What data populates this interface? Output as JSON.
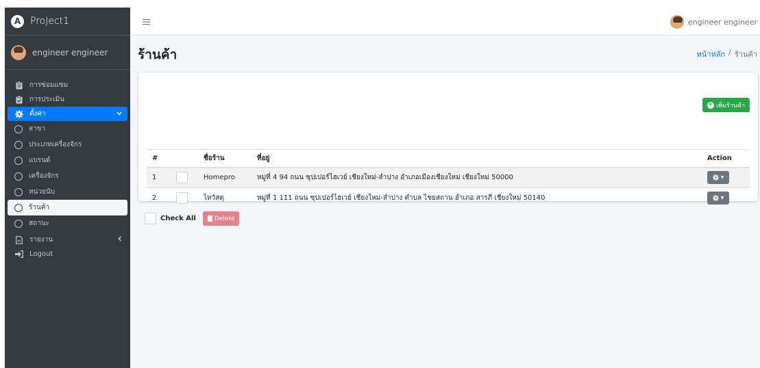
{
  "brand": {
    "logo_letter": "A",
    "name": "ProJect1"
  },
  "user": {
    "name": "engineer engineer"
  },
  "sidebar": {
    "items": [
      {
        "label": "การซ่อมแซม",
        "icon": "clipboard-icon"
      },
      {
        "label": "การประเมิน",
        "icon": "clipboard-check-icon"
      },
      {
        "label": "ตั้งค่า",
        "icon": "gear-icon",
        "active": true
      }
    ],
    "settings_sub": [
      {
        "label": "สาขา"
      },
      {
        "label": "ประเภทเครื่องจักร"
      },
      {
        "label": "แบรนด์"
      },
      {
        "label": "เครื่องจักร"
      },
      {
        "label": "หน่วยนับ"
      },
      {
        "label": "ร้านค้า",
        "current": true
      },
      {
        "label": "สถานะ"
      }
    ],
    "report": {
      "label": "รายงาน",
      "icon": "pdf-icon"
    },
    "logout": {
      "label": "Logout",
      "icon": "logout-icon"
    }
  },
  "page": {
    "title": "ร้านค้า",
    "breadcrumb": {
      "home": "หน้าหลัก",
      "sep": "/",
      "current": "ร้านค้า"
    }
  },
  "actions": {
    "add_label": "เพิ่มร้านค้า",
    "check_all_label": "Check All",
    "delete_label": "Delete"
  },
  "table": {
    "headers": {
      "num": "#",
      "name": "ชื่อร้าน",
      "address": "ที่อยู่",
      "action": "Action"
    },
    "rows": [
      {
        "num": "1",
        "name": "Homepro",
        "address": "หมู่ที่ 4 94 ถนน ซุปเปอร์ไฮเวย์ เชียงใหม่-ลำปาง อำเภอเมืองเชียงใหม่ เชียงใหม่ 50000"
      },
      {
        "num": "2",
        "name": "ไทวัสดุ",
        "address": "หมู่ที่ 1 111 ถนน ซุปเปอร์ไฮเวย์ เชียงใหม่-ลำปาง ตำบล ไชยสถาน อำเภอ สารภี เชียงใหม่ 50140"
      }
    ]
  },
  "colors": {
    "sidebar": "#343a40",
    "active": "#007bff",
    "add": "#28a745",
    "delete": "#e4818a",
    "action": "#6c757d"
  }
}
